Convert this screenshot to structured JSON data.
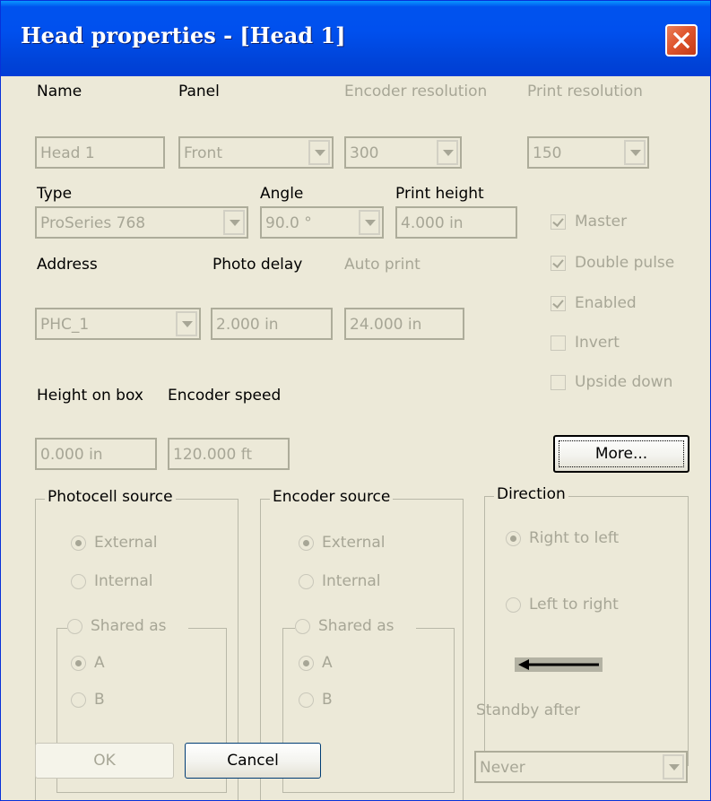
{
  "window": {
    "title": "Head properties - [Head 1]",
    "close_icon": "close-icon"
  },
  "labels": {
    "name": "Name",
    "panel": "Panel",
    "encoder_resolution": "Encoder resolution",
    "print_resolution": "Print resolution",
    "type": "Type",
    "angle": "Angle",
    "print_height": "Print height",
    "address": "Address",
    "photo_delay": "Photo delay",
    "auto_print": "Auto print",
    "height_on_box": "Height on box",
    "encoder_speed": "Encoder speed",
    "standby_after": "Standby after"
  },
  "fields": {
    "name": "Head 1",
    "panel": "Front",
    "encoder_resolution": "300",
    "print_resolution": "150",
    "type": "ProSeries 768",
    "angle": "90.0 °",
    "print_height": "4.000 in",
    "address": "PHC_1",
    "photo_delay": "2.000 in",
    "auto_print": "24.000 in",
    "height_on_box": "0.000 in",
    "encoder_speed": "120.000 ft",
    "standby_after": "Never"
  },
  "checkboxes": [
    {
      "label": "Master",
      "checked": true
    },
    {
      "label": "Double pulse",
      "checked": true
    },
    {
      "label": "Enabled",
      "checked": true
    },
    {
      "label": "Invert",
      "checked": false
    },
    {
      "label": "Upside down",
      "checked": false
    }
  ],
  "buttons": {
    "more": "More...",
    "ok": "OK",
    "cancel": "Cancel"
  },
  "photocell_source": {
    "title": "Photocell source",
    "external": "External",
    "internal": "Internal",
    "shared_as": "Shared as",
    "a": "A",
    "b": "B"
  },
  "encoder_source": {
    "title": "Encoder source",
    "external": "External",
    "internal": "Internal",
    "shared_as": "Shared as",
    "a": "A",
    "b": "B"
  },
  "direction": {
    "title": "Direction",
    "right_to_left": "Right to left",
    "left_to_right": "Left to right",
    "arrow_icon": "arrow-left-icon"
  },
  "colors": {
    "title_bar": "#0054e3",
    "face": "#ece9d8",
    "disabled_text": "#a7a696",
    "close_button": "#e0562e"
  }
}
